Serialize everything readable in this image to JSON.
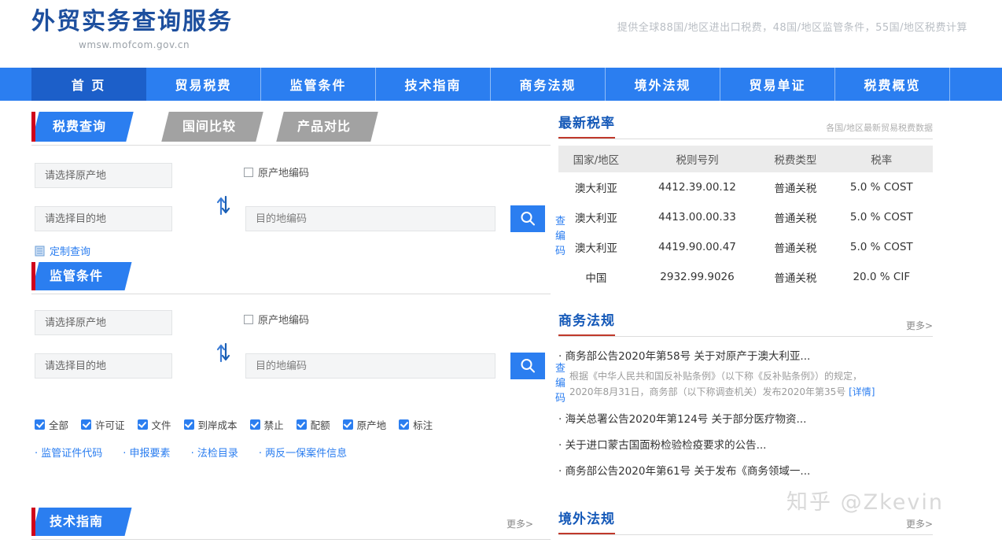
{
  "header": {
    "title": "外贸实务查询服务",
    "subtitle": "wmsw.mofcom.gov.cn",
    "tagline": "提供全球88国/地区进出口税费，48国/地区监管条件，55国/地区税费计算"
  },
  "nav": {
    "items": [
      {
        "label": "首 页",
        "active": true
      },
      {
        "label": "贸易税费",
        "active": false
      },
      {
        "label": "监管条件",
        "active": false
      },
      {
        "label": "技术指南",
        "active": false
      },
      {
        "label": "商务法规",
        "active": false
      },
      {
        "label": "境外法规",
        "active": false
      },
      {
        "label": "贸易单证",
        "active": false
      },
      {
        "label": "税费概览",
        "active": false
      }
    ]
  },
  "tabs": [
    {
      "label": "税费查询",
      "active": true
    },
    {
      "label": "国间比较",
      "active": false
    },
    {
      "label": "产品对比",
      "active": false
    }
  ],
  "tax_form": {
    "origin_placeholder": "请选择原产地",
    "dest_placeholder": "请选择目的地",
    "origin_code_label": "原产地编码",
    "dest_code_placeholder": "目的地编码",
    "search_icon": "search-icon",
    "code_link": "查编码",
    "custom_query": "定制查询"
  },
  "regulation": {
    "section_title": "监管条件",
    "origin_placeholder": "请选择原产地",
    "dest_placeholder": "请选择目的地",
    "origin_code_label": "原产地编码",
    "dest_code_placeholder": "目的地编码",
    "code_link": "查编码",
    "checkboxes": [
      "全部",
      "许可证",
      "文件",
      "到岸成本",
      "禁止",
      "配额",
      "原产地",
      "标注"
    ],
    "links": [
      "监管证件代码",
      "申报要素",
      "法检目录",
      "两反一保案件信息"
    ]
  },
  "tech_guide": {
    "section_title": "技术指南",
    "more": "更多>"
  },
  "latest_rates": {
    "title": "最新税率",
    "note": "各国/地区最新贸易税费数据",
    "columns": [
      "国家/地区",
      "税则号列",
      "税费类型",
      "税率"
    ],
    "rows": [
      [
        "澳大利亚",
        "4412.39.00.12",
        "普通关税",
        "5.0 % COST"
      ],
      [
        "澳大利亚",
        "4413.00.00.33",
        "普通关税",
        "5.0 % COST"
      ],
      [
        "澳大利亚",
        "4419.90.00.47",
        "普通关税",
        "5.0 % COST"
      ],
      [
        "中国",
        "2932.99.9026",
        "普通关税",
        "20.0 % CIF"
      ]
    ]
  },
  "business_laws": {
    "title": "商务法规",
    "more": "更多>",
    "items": [
      {
        "title": "商务部公告2020年第58号 关于对原产于澳大利亚...",
        "desc_line1": "根据《中华人民共和国反补贴条例》（以下称《反补贴条例》）的规定，",
        "desc_line2": "2020年8月31日，商务部（以下称调查机关）发布2020年第35号",
        "detail": "[详情]"
      },
      {
        "title": "海关总署公告2020年第124号 关于部分医疗物资..."
      },
      {
        "title": "关于进口蒙古国面粉检验检疫要求的公告..."
      },
      {
        "title": "商务部公告2020年第61号 关于发布《商务领域一..."
      }
    ]
  },
  "overseas_laws": {
    "title": "境外法规",
    "more": "更多>"
  },
  "watermark": "知乎 @Zkevin",
  "colors": {
    "brand_blue": "#1d4f9e",
    "nav_blue": "#2b7ef0",
    "nav_active_blue": "#1c5fc9",
    "accent_red": "#d0021b",
    "link_blue": "#2b7ef0"
  }
}
